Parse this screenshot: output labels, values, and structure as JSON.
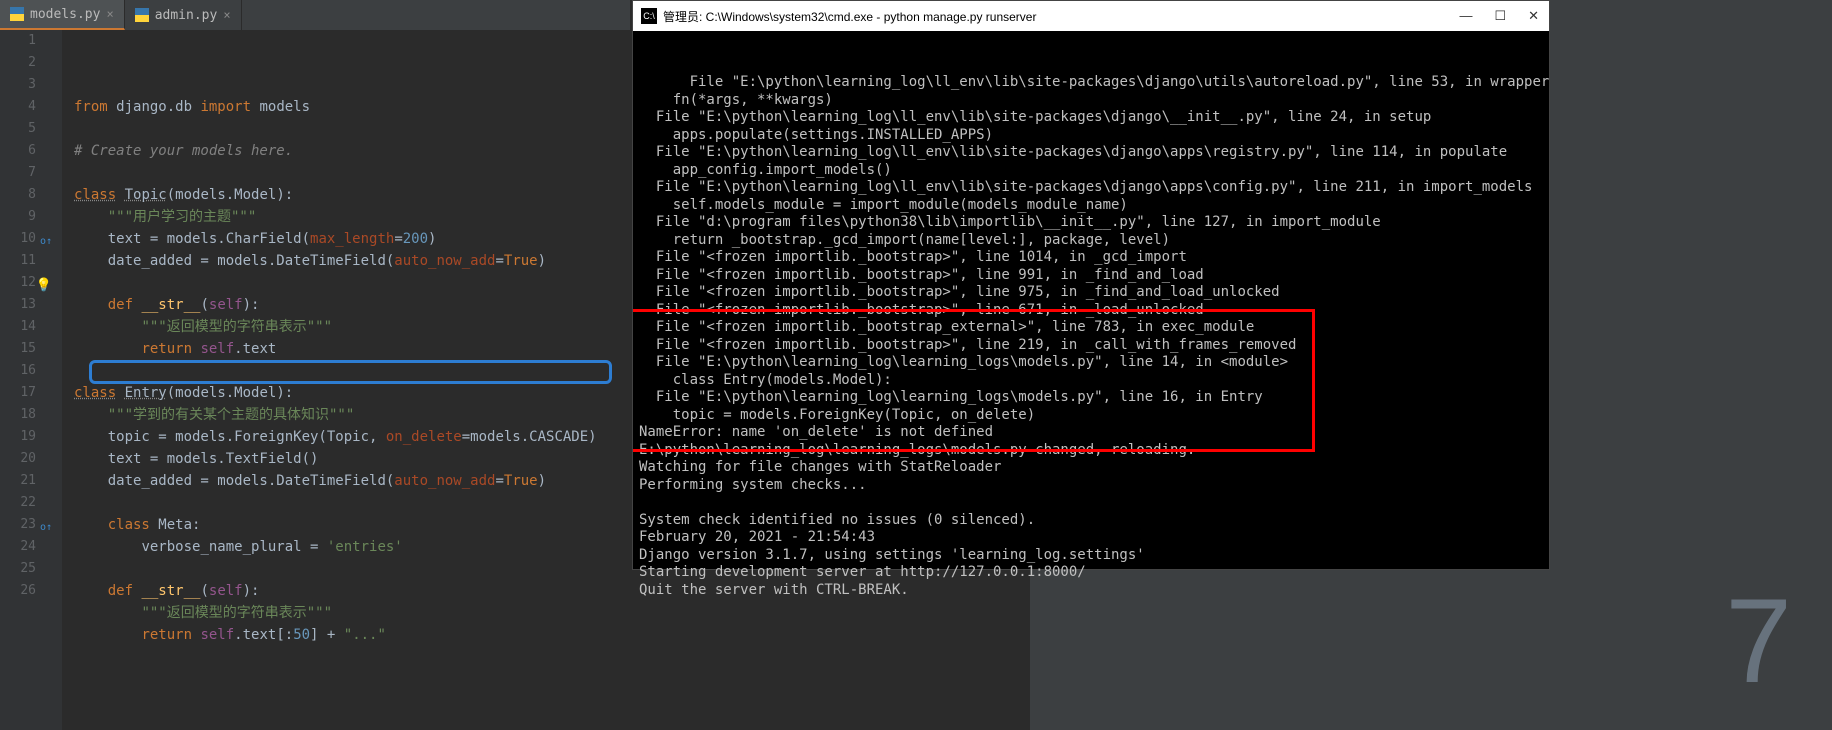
{
  "editor": {
    "tabs": [
      {
        "label": "models.py",
        "active": true
      },
      {
        "label": "admin.py",
        "active": false
      }
    ],
    "lines": [
      {
        "n": "1",
        "html": "<span class='kw'>from</span> <span class='plain'>django.db</span> <span class='kw'>import</span> <span class='plain'>models</span>"
      },
      {
        "n": "2",
        "html": ""
      },
      {
        "n": "3",
        "html": "<span class='cmt'># Create your models here.</span>"
      },
      {
        "n": "4",
        "html": ""
      },
      {
        "n": "5",
        "html": "<span class='kw-uline'>class</span> <span class='cls'>Topic</span><span class='plain'>(models.Model):</span>"
      },
      {
        "n": "6",
        "html": "    <span class='str'>\"\"\"用户学习的主题\"\"\"</span>"
      },
      {
        "n": "7",
        "html": "    <span class='plain'>text = models.CharField(</span><span class='param'>max_length</span><span class='plain'>=</span><span class='num'>200</span><span class='plain'>)</span>"
      },
      {
        "n": "8",
        "html": "    <span class='plain'>date_added = models.DateTimeField(</span><span class='param'>auto_now_add</span><span class='plain'>=</span><span class='kw'>True</span><span class='plain'>)</span>"
      },
      {
        "n": "9",
        "html": ""
      },
      {
        "n": "10",
        "icon": "override",
        "html": "    <span class='kw'>def </span><span class='fn'>__str__</span><span class='plain'>(</span><span class='self'>self</span><span class='plain'>):</span>"
      },
      {
        "n": "11",
        "html": "        <span class='str'>\"\"\"返回模型的字符串表示\"\"\"</span>"
      },
      {
        "n": "12",
        "icon": "bulb",
        "html": "        <span class='kw'>return </span><span class='self'>self</span><span class='plain'>.text</span>"
      },
      {
        "n": "13",
        "html": ""
      },
      {
        "n": "14",
        "html": "<span class='kw-uline'>class</span> <span class='cls'>Entry</span><span class='plain'>(models.Model):</span>"
      },
      {
        "n": "15",
        "html": "    <span class='str'>\"\"\"学到的有关某个主题的具体知识\"\"\"</span>"
      },
      {
        "n": "16",
        "html": "    <span class='plain'>topic = models.ForeignKey(Topic</span><span class='plain'>, </span><span class='param'>on_delete</span><span class='plain'>=models.CASCADE)</span>"
      },
      {
        "n": "17",
        "html": "    <span class='plain'>text = models.TextField()</span>"
      },
      {
        "n": "18",
        "html": "    <span class='plain'>date_added = models.DateTimeField(</span><span class='param'>auto_now_add</span><span class='plain'>=</span><span class='kw'>True</span><span class='plain'>)</span>"
      },
      {
        "n": "19",
        "html": ""
      },
      {
        "n": "20",
        "html": "    <span class='kw'>class </span><span class='plain'>Meta:</span>"
      },
      {
        "n": "21",
        "html": "        <span class='plain'>verbose_name_plural = </span><span class='str'>'entries'</span>"
      },
      {
        "n": "22",
        "html": ""
      },
      {
        "n": "23",
        "icon": "override",
        "html": "    <span class='kw'>def </span><span class='fn'>__str__</span><span class='plain'>(</span><span class='self'>self</span><span class='plain'>):</span>"
      },
      {
        "n": "24",
        "html": "        <span class='str'>\"\"\"返回模型的字符串表示\"\"\"</span>"
      },
      {
        "n": "25",
        "html": "        <span class='kw'>return </span><span class='self'>self</span><span class='plain'>.text[:</span><span class='num'>50</span><span class='plain'>] + </span><span class='str'>\"...\"</span>"
      },
      {
        "n": "26",
        "html": ""
      }
    ]
  },
  "terminal": {
    "title": "管理员: C:\\Windows\\system32\\cmd.exe - python  manage.py runserver",
    "body": "  File \"E:\\python\\learning_log\\ll_env\\lib\\site-packages\\django\\utils\\autoreload.py\", line 53, in wrapper\n    fn(*args, **kwargs)\n  File \"E:\\python\\learning_log\\ll_env\\lib\\site-packages\\django\\__init__.py\", line 24, in setup\n    apps.populate(settings.INSTALLED_APPS)\n  File \"E:\\python\\learning_log\\ll_env\\lib\\site-packages\\django\\apps\\registry.py\", line 114, in populate\n    app_config.import_models()\n  File \"E:\\python\\learning_log\\ll_env\\lib\\site-packages\\django\\apps\\config.py\", line 211, in import_models\n    self.models_module = import_module(models_module_name)\n  File \"d:\\program files\\python38\\lib\\importlib\\__init__.py\", line 127, in import_module\n    return _bootstrap._gcd_import(name[level:], package, level)\n  File \"<frozen importlib._bootstrap>\", line 1014, in _gcd_import\n  File \"<frozen importlib._bootstrap>\", line 991, in _find_and_load\n  File \"<frozen importlib._bootstrap>\", line 975, in _find_and_load_unlocked\n  File \"<frozen importlib._bootstrap>\", line 671, in _load_unlocked\n  File \"<frozen importlib._bootstrap_external>\", line 783, in exec_module\n  File \"<frozen importlib._bootstrap>\", line 219, in _call_with_frames_removed\n  File \"E:\\python\\learning_log\\learning_logs\\models.py\", line 14, in <module>\n    class Entry(models.Model):\n  File \"E:\\python\\learning_log\\learning_logs\\models.py\", line 16, in Entry\n    topic = models.ForeignKey(Topic, on_delete)\nNameError: name 'on_delete' is not defined\nE:\\python\\learning_log\\learning_logs\\models.py changed, reloading.\nWatching for file changes with StatReloader\nPerforming system checks...\n\nSystem check identified no issues (0 silenced).\nFebruary 20, 2021 - 21:54:43\nDjango version 3.1.7, using settings 'learning_log.settings'\nStarting development server at http://127.0.0.1:8000/\nQuit the server with CTRL-BREAK."
  },
  "desktop_corner": "7"
}
